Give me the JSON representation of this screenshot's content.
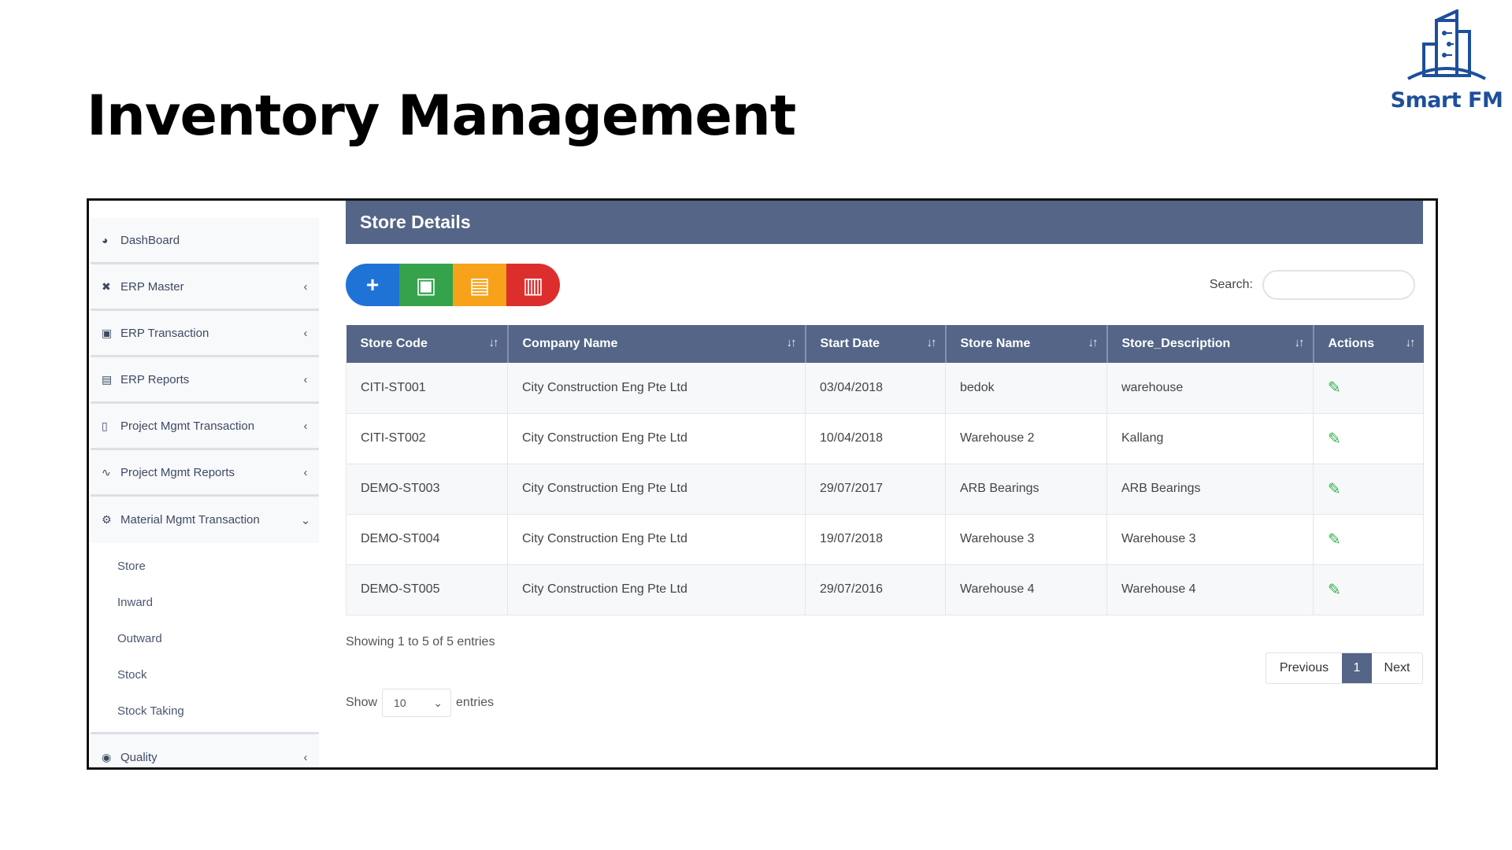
{
  "slide": {
    "title": "Inventory Management",
    "logo_text": "Smart FM",
    "logo_color": "#1d4f9c"
  },
  "sidebar": {
    "items": [
      {
        "label": "DashBoard",
        "icon": "dashboard-icon",
        "chevron": ""
      },
      {
        "label": "ERP Master",
        "icon": "cross-icon",
        "chevron": "‹"
      },
      {
        "label": "ERP Transaction",
        "icon": "box-icon",
        "chevron": "‹"
      },
      {
        "label": "ERP Reports",
        "icon": "file-icon",
        "chevron": "‹"
      },
      {
        "label": "Project Mgmt Transaction",
        "icon": "document-icon",
        "chevron": "‹"
      },
      {
        "label": "Project Mgmt Reports",
        "icon": "chart-icon",
        "chevron": "‹"
      },
      {
        "label": "Material Mgmt Transaction",
        "icon": "gears-icon",
        "chevron": "⌄"
      }
    ],
    "sub_items": [
      "Store",
      "Inward",
      "Outward",
      "Stock",
      "Stock Taking"
    ],
    "last_item": {
      "label": "Quality",
      "icon": "eye-icon",
      "chevron": "‹"
    }
  },
  "panel": {
    "title": "Store Details",
    "header_color": "#546587"
  },
  "toolbar": {
    "add_icon": "+",
    "excel_icon": "▣",
    "csv_icon": "▤",
    "pdf_icon": "▥"
  },
  "search": {
    "label": "Search:",
    "value": ""
  },
  "table": {
    "columns": [
      "Store Code",
      "Company Name",
      "Start Date",
      "Store Name",
      "Store_Description",
      "Actions"
    ],
    "rows": [
      [
        "CITI-ST001",
        "City Construction Eng Pte Ltd",
        "03/04/2018",
        "bedok",
        "warehouse"
      ],
      [
        "CITI-ST002",
        "City Construction Eng Pte Ltd",
        "10/04/2018",
        "Warehouse 2",
        "Kallang"
      ],
      [
        "DEMO-ST003",
        "City Construction Eng Pte Ltd",
        "29/07/2017",
        "ARB Bearings",
        "ARB Bearings"
      ],
      [
        "DEMO-ST004",
        "City Construction Eng Pte Ltd",
        "19/07/2018",
        "Warehouse 3",
        "Warehouse 3"
      ],
      [
        "DEMO-ST005",
        "City Construction Eng Pte Ltd",
        "29/07/2016",
        "Warehouse 4",
        "Warehouse 4"
      ]
    ]
  },
  "footer": {
    "info": "Showing 1 to 5 of 5 entries",
    "prev": "Previous",
    "page": "1",
    "next": "Next",
    "show_label": "Show",
    "show_value": "10",
    "entries_label": "entries"
  }
}
